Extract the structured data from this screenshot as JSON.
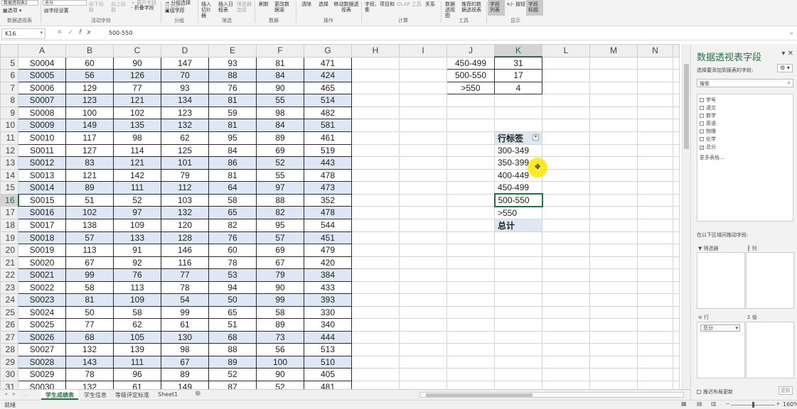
{
  "ribbon": {
    "items": {
      "pivot_name": "数据透视表2",
      "options": "选项",
      "group_label_pivot": "数据透视表",
      "active_field": "总分",
      "field_settings": "字段设置",
      "drill_down": "向下钻取",
      "drill_up": "向上钻取",
      "expand_field": "+ 展开字段",
      "collapse_field": "- 折叠字段",
      "group_label_active": "活动字段",
      "group_selection": "→ 分组选择",
      "ungroup": "取消组合",
      "group_field": "组字段",
      "group_label_group": "分组",
      "insert_slicer": "插入切片器",
      "insert_timeline": "插入日程表",
      "filter_conn": "筛选器连接",
      "group_label_filter": "筛选",
      "refresh": "刷新",
      "change_source": "更改数据源",
      "group_label_data": "数据",
      "clear": "清除",
      "select": "选择",
      "move_pivot": "移动数据透视表",
      "group_label_ops": "操作",
      "fields_items": "字段、项目和集",
      "olap": "OLAP 工具",
      "relations": "关系",
      "group_label_calc": "计算",
      "pivot_chart": "数据透视图",
      "recommended": "推荐的数据透视表",
      "group_label_tools": "工具",
      "field_list": "字段列表",
      "buttons": "+/- 按钮",
      "field_headers": "字段标题",
      "group_label_show": "显示"
    }
  },
  "formula_bar": {
    "name_box": "K16",
    "value": "500-550"
  },
  "grid": {
    "col_headers": [
      "A",
      "B",
      "C",
      "D",
      "E",
      "F",
      "G",
      "H",
      "I",
      "J",
      "K",
      "L",
      "M",
      "N"
    ],
    "rows": [
      {
        "r": "5",
        "a": "S0004",
        "b": "60",
        "c": "90",
        "d": "147",
        "e": "93",
        "f": "81",
        "g": "471",
        "j": "450-499",
        "k": "31"
      },
      {
        "r": "6",
        "a": "S0005",
        "b": "56",
        "c": "126",
        "d": "70",
        "e": "88",
        "f": "84",
        "g": "424",
        "j": "500-550",
        "k": "17"
      },
      {
        "r": "7",
        "a": "S0006",
        "b": "129",
        "c": "77",
        "d": "93",
        "e": "76",
        "f": "90",
        "g": "465",
        "j": ">550",
        "k": "4"
      },
      {
        "r": "8",
        "a": "S0007",
        "b": "123",
        "c": "121",
        "d": "134",
        "e": "81",
        "f": "55",
        "g": "514"
      },
      {
        "r": "9",
        "a": "S0008",
        "b": "100",
        "c": "102",
        "d": "123",
        "e": "59",
        "f": "98",
        "g": "482"
      },
      {
        "r": "10",
        "a": "S0009",
        "b": "149",
        "c": "135",
        "d": "132",
        "e": "81",
        "f": "84",
        "g": "581"
      },
      {
        "r": "11",
        "a": "S0010",
        "b": "117",
        "c": "98",
        "d": "62",
        "e": "95",
        "f": "89",
        "g": "461",
        "k": "行标签"
      },
      {
        "r": "12",
        "a": "S0011",
        "b": "127",
        "c": "114",
        "d": "125",
        "e": "84",
        "f": "69",
        "g": "519",
        "k": "300-349"
      },
      {
        "r": "13",
        "a": "S0012",
        "b": "83",
        "c": "121",
        "d": "101",
        "e": "86",
        "f": "52",
        "g": "443",
        "k": "350-399"
      },
      {
        "r": "14",
        "a": "S0013",
        "b": "121",
        "c": "142",
        "d": "79",
        "e": "81",
        "f": "55",
        "g": "478",
        "k": "400-449"
      },
      {
        "r": "15",
        "a": "S0014",
        "b": "89",
        "c": "111",
        "d": "112",
        "e": "64",
        "f": "97",
        "g": "473",
        "k": "450-499"
      },
      {
        "r": "16",
        "a": "S0015",
        "b": "51",
        "c": "52",
        "d": "103",
        "e": "58",
        "f": "88",
        "g": "352",
        "k": "500-550"
      },
      {
        "r": "17",
        "a": "S0016",
        "b": "102",
        "c": "97",
        "d": "132",
        "e": "65",
        "f": "82",
        "g": "478",
        "k": ">550"
      },
      {
        "r": "18",
        "a": "S0017",
        "b": "138",
        "c": "109",
        "d": "120",
        "e": "82",
        "f": "95",
        "g": "544",
        "k": "总计"
      },
      {
        "r": "19",
        "a": "S0018",
        "b": "57",
        "c": "133",
        "d": "128",
        "e": "76",
        "f": "57",
        "g": "451"
      },
      {
        "r": "20",
        "a": "S0019",
        "b": "113",
        "c": "91",
        "d": "146",
        "e": "60",
        "f": "69",
        "g": "479"
      },
      {
        "r": "21",
        "a": "S0020",
        "b": "67",
        "c": "92",
        "d": "116",
        "e": "78",
        "f": "67",
        "g": "420"
      },
      {
        "r": "22",
        "a": "S0021",
        "b": "99",
        "c": "76",
        "d": "77",
        "e": "53",
        "f": "79",
        "g": "384"
      },
      {
        "r": "23",
        "a": "S0022",
        "b": "58",
        "c": "113",
        "d": "78",
        "e": "94",
        "f": "90",
        "g": "433"
      },
      {
        "r": "24",
        "a": "S0023",
        "b": "81",
        "c": "109",
        "d": "54",
        "e": "50",
        "f": "99",
        "g": "393"
      },
      {
        "r": "25",
        "a": "S0024",
        "b": "50",
        "c": "58",
        "d": "99",
        "e": "65",
        "f": "58",
        "g": "330"
      },
      {
        "r": "26",
        "a": "S0025",
        "b": "77",
        "c": "62",
        "d": "61",
        "e": "51",
        "f": "89",
        "g": "340"
      },
      {
        "r": "27",
        "a": "S0026",
        "b": "68",
        "c": "105",
        "d": "130",
        "e": "68",
        "f": "73",
        "g": "444"
      },
      {
        "r": "28",
        "a": "S0027",
        "b": "132",
        "c": "139",
        "d": "98",
        "e": "88",
        "f": "56",
        "g": "513"
      },
      {
        "r": "29",
        "a": "S0028",
        "b": "143",
        "c": "111",
        "d": "67",
        "e": "89",
        "f": "100",
        "g": "510"
      },
      {
        "r": "30",
        "a": "S0029",
        "b": "78",
        "c": "96",
        "d": "89",
        "e": "52",
        "f": "90",
        "g": "405"
      },
      {
        "r": "31",
        "a": "S0030",
        "b": "132",
        "c": "61",
        "d": "149",
        "e": "87",
        "f": "52",
        "g": "481"
      }
    ]
  },
  "sheet_tabs": [
    "学生成绩表",
    "学生信息",
    "等级评定标准",
    "Sheet1"
  ],
  "status": {
    "ready": "就绪",
    "zoom": "160%"
  },
  "pivot_pane": {
    "title": "数据透视表字段",
    "subtitle": "选择要添加到报表的字段:",
    "search_placeholder": "搜索",
    "fields": [
      {
        "label": "学号",
        "checked": false
      },
      {
        "label": "语文",
        "checked": false
      },
      {
        "label": "数学",
        "checked": false
      },
      {
        "label": "英语",
        "checked": false
      },
      {
        "label": "物理",
        "checked": false
      },
      {
        "label": "化学",
        "checked": false
      },
      {
        "label": "总分",
        "checked": true
      }
    ],
    "more_tables": "更多表格...",
    "drag_label": "在以下区域间拖动字段:",
    "filters_label": "筛选器",
    "columns_label": "列",
    "rows_label": "行",
    "values_label": "值",
    "row_chip": "总分",
    "defer_label": "推迟布局更新",
    "update_button": "更新"
  }
}
